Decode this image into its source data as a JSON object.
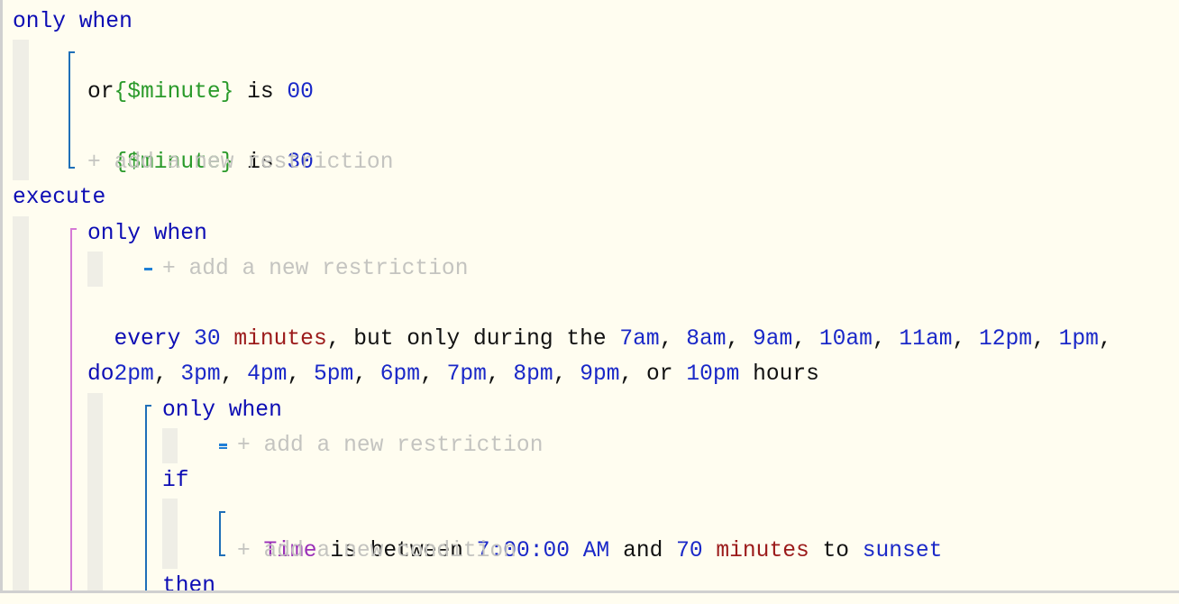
{
  "editor": {
    "root_only_when": {
      "keyword": "only when"
    },
    "restrictions": [
      {
        "variable": "{$minute}",
        "operator": "is",
        "value": "00"
      },
      {
        "joiner": "or"
      },
      {
        "variable": "{$minute}",
        "operator": "is",
        "value": "30"
      }
    ],
    "add_restriction_hint": "+ add a new restriction",
    "execute_keyword": "execute",
    "execute_block": {
      "only_when_keyword": "only when",
      "add_restriction_hint": "+ add a new restriction",
      "schedule": {
        "every_keyword": "every",
        "interval": "30",
        "unit": "minutes",
        "middle_text": ", but only during the ",
        "hours": [
          "7am",
          "8am",
          "9am",
          "10am",
          "11am",
          "12pm",
          "1pm",
          "2pm",
          "3pm",
          "4pm",
          "5pm",
          "6pm",
          "7pm",
          "8pm",
          "9pm",
          "10pm"
        ],
        "or_text": "or",
        "hours_suffix": "hours"
      },
      "do_keyword": "do",
      "do_block": {
        "only_when_keyword": "only when",
        "add_restriction_hint": "+ add a new restriction",
        "if_keyword": "if",
        "condition": {
          "subject": "Time",
          "operator": "is between",
          "start": "7:00:00 AM",
          "and_text": "and",
          "offset": "70",
          "offset_unit": "minutes",
          "to_text": "to",
          "event": "sunset"
        },
        "add_condition_hint": "+ add a new condition",
        "then_keyword": "then"
      }
    }
  },
  "colors": {
    "background": "#fffdf0",
    "keyword": "#0c0cb4",
    "variable": "#2a9a2a",
    "value": "#1a28c8",
    "unit": "#9b1a1a",
    "subject": "#9a2fb8",
    "hint": "#c4c4c0",
    "bracket_blue": "#1f6fb8",
    "bracket_pink": "#d67ad6"
  }
}
